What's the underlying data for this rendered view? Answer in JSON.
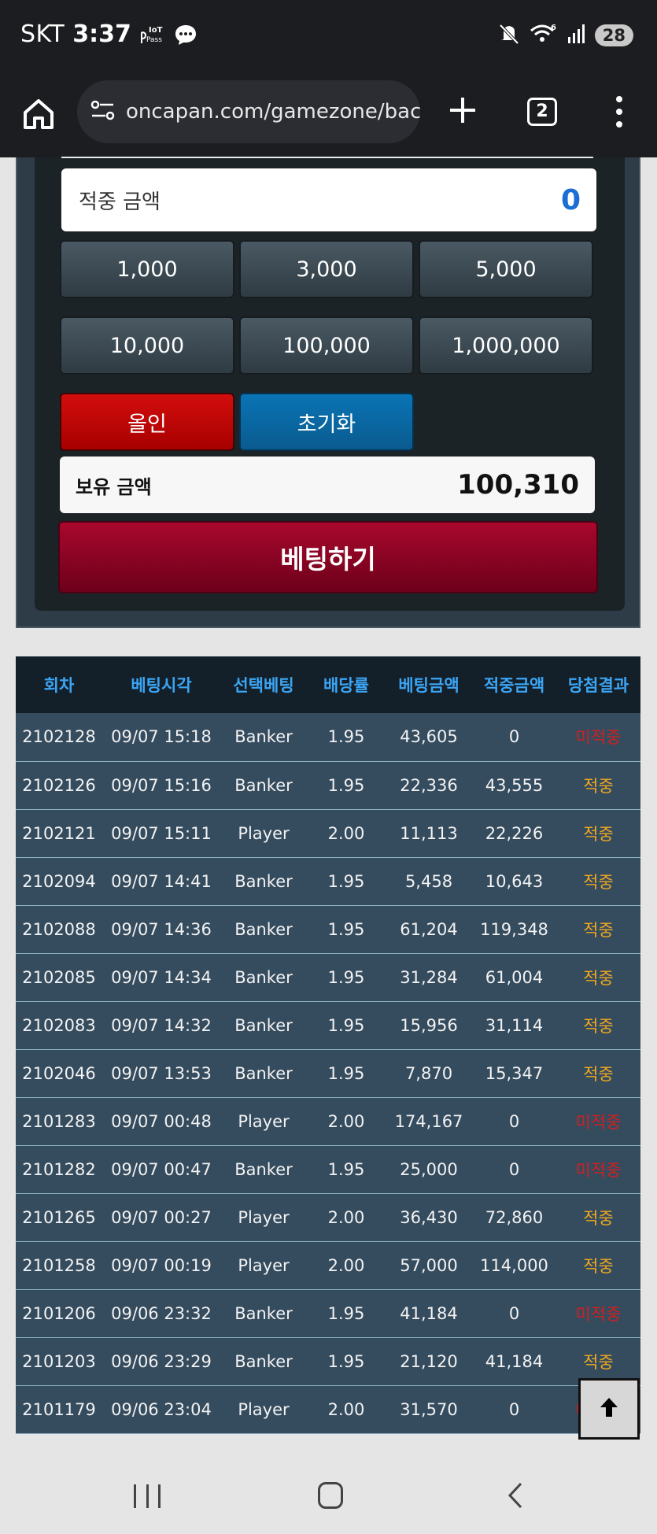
{
  "status": {
    "carrier": "SKT",
    "time": "3:37",
    "battery": "28",
    "icons": [
      "iot-pass-icon",
      "chat-bubble-icon",
      "mute-icon",
      "wifi-6-icon",
      "signal-icon",
      "battery-icon"
    ]
  },
  "browser": {
    "url": "oncapan.com/gamezone/bacc",
    "tab_count": "2",
    "icons": [
      "home-icon",
      "site-settings-icon",
      "plus-icon",
      "tabs-icon",
      "more-menu-icon"
    ]
  },
  "panel": {
    "win_label": "적중 금액",
    "win_value": "0",
    "amount_buttons": [
      "1,000",
      "3,000",
      "5,000",
      "10,000",
      "100,000",
      "1,000,000"
    ],
    "allin_label": "올인",
    "reset_label": "초기화",
    "balance_label": "보유 금액",
    "balance_value": "100,310",
    "bet_label": "베팅하기"
  },
  "history": {
    "headers": [
      "회차",
      "베팅시각",
      "선택베팅",
      "배당률",
      "베팅금액",
      "적중금액",
      "당첨결과"
    ],
    "rows": [
      [
        "2102128",
        "09/07 15:18",
        "Banker",
        "1.95",
        "43,605",
        "0",
        "미적중"
      ],
      [
        "2102126",
        "09/07 15:16",
        "Banker",
        "1.95",
        "22,336",
        "43,555",
        "적중"
      ],
      [
        "2102121",
        "09/07 15:11",
        "Player",
        "2.00",
        "11,113",
        "22,226",
        "적중"
      ],
      [
        "2102094",
        "09/07 14:41",
        "Banker",
        "1.95",
        "5,458",
        "10,643",
        "적중"
      ],
      [
        "2102088",
        "09/07 14:36",
        "Banker",
        "1.95",
        "61,204",
        "119,348",
        "적중"
      ],
      [
        "2102085",
        "09/07 14:34",
        "Banker",
        "1.95",
        "31,284",
        "61,004",
        "적중"
      ],
      [
        "2102083",
        "09/07 14:32",
        "Banker",
        "1.95",
        "15,956",
        "31,114",
        "적중"
      ],
      [
        "2102046",
        "09/07 13:53",
        "Banker",
        "1.95",
        "7,870",
        "15,347",
        "적중"
      ],
      [
        "2101283",
        "09/07 00:48",
        "Player",
        "2.00",
        "174,167",
        "0",
        "미적중"
      ],
      [
        "2101282",
        "09/07 00:47",
        "Banker",
        "1.95",
        "25,000",
        "0",
        "미적중"
      ],
      [
        "2101265",
        "09/07 00:27",
        "Player",
        "2.00",
        "36,430",
        "72,860",
        "적중"
      ],
      [
        "2101258",
        "09/07 00:19",
        "Player",
        "2.00",
        "57,000",
        "114,000",
        "적중"
      ],
      [
        "2101206",
        "09/06 23:32",
        "Banker",
        "1.95",
        "41,184",
        "0",
        "미적중"
      ],
      [
        "2101203",
        "09/06 23:29",
        "Banker",
        "1.95",
        "21,120",
        "41,184",
        "적중"
      ],
      [
        "2101179",
        "09/06 23:04",
        "Player",
        "2.00",
        "31,570",
        "0",
        "미적중"
      ]
    ],
    "result_colors": {
      "적중": "#f0a81e",
      "미적중": "#d21f1f"
    }
  },
  "nav": {
    "icons": [
      "recent-apps-icon",
      "home-circle-icon",
      "back-icon",
      "scroll-top-icon"
    ]
  }
}
